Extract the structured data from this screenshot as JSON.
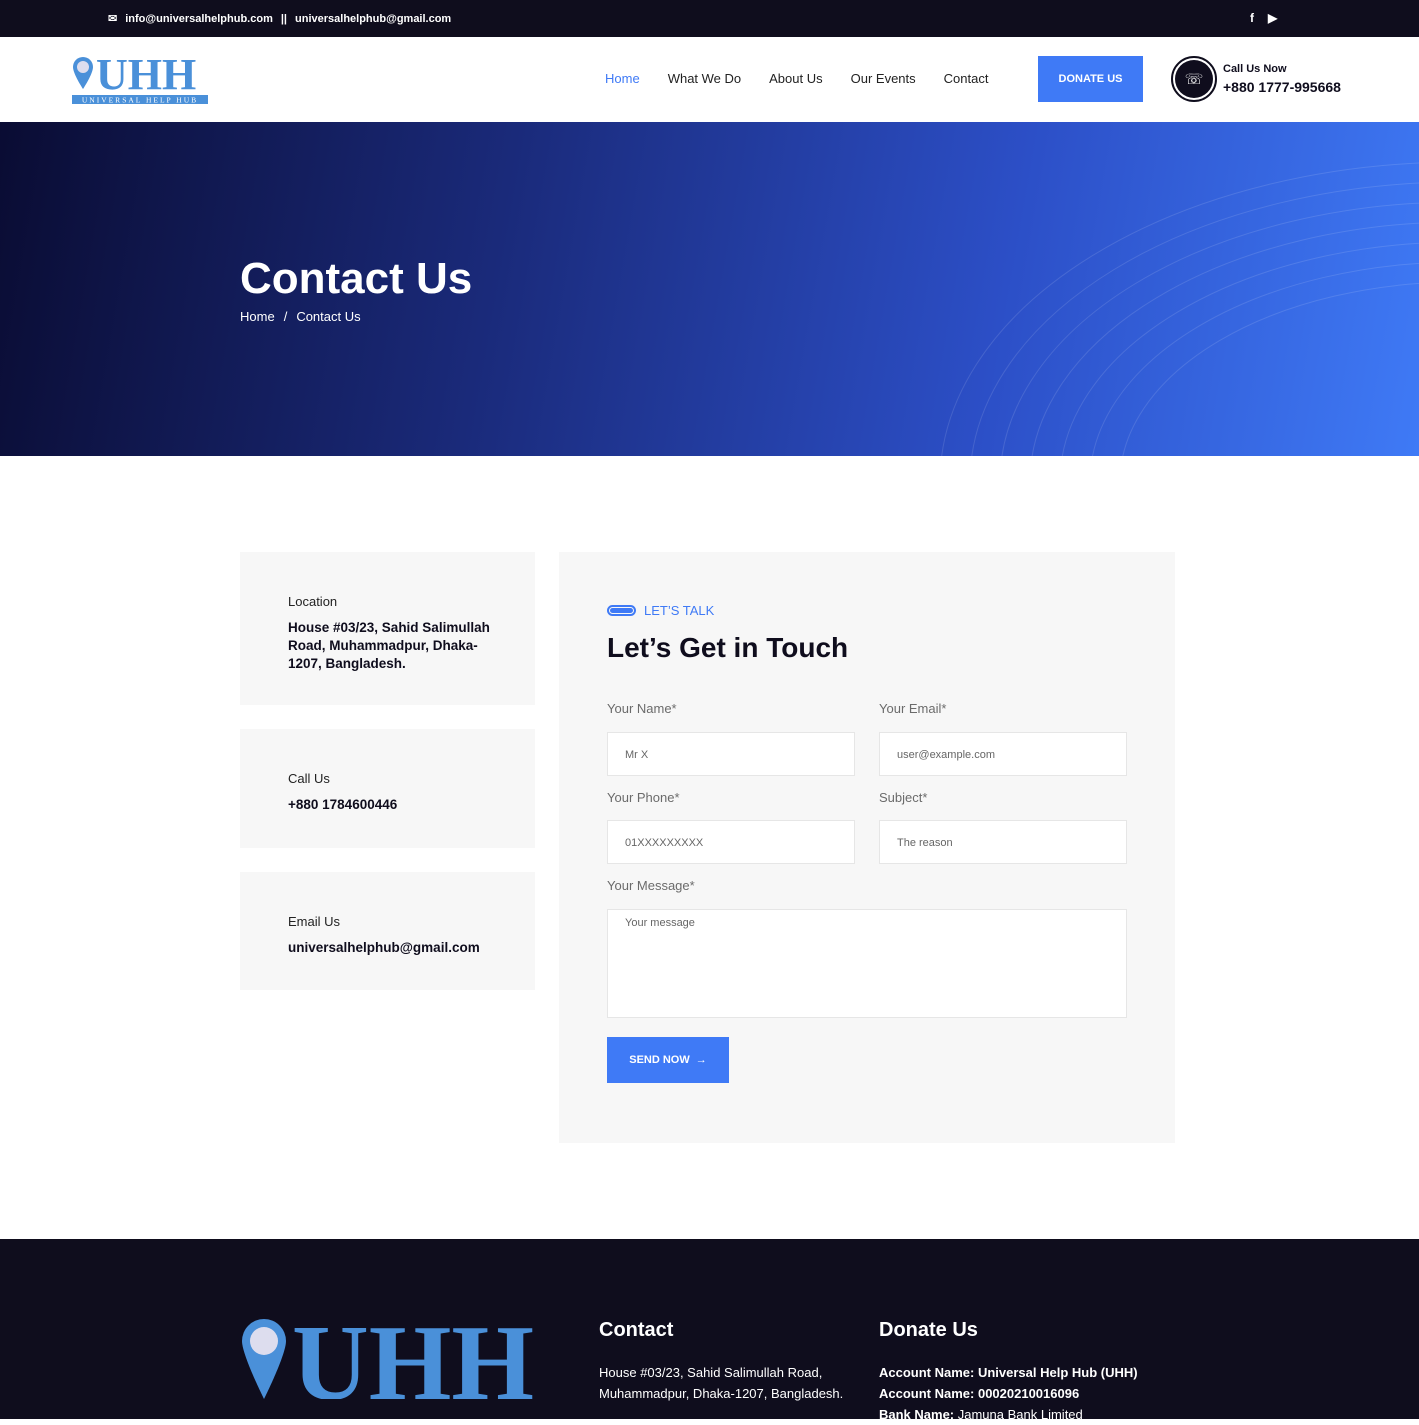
{
  "topbar": {
    "email1": "info@universalhelphub.com",
    "separator": "||",
    "email2": "universalhelphub@gmail.com"
  },
  "header": {
    "logo_text": "UHH",
    "logo_sub": "UNIVERSAL HELP HUB",
    "nav": [
      "Home",
      "What We Do",
      "About Us",
      "Our Events",
      "Contact"
    ],
    "donate": "DONATE US",
    "call_label": "Call Us Now",
    "call_number": "+880 1777-995668"
  },
  "hero": {
    "title": "Contact Us",
    "crumb_home": "Home",
    "crumb_sep": "/",
    "crumb_current": "Contact Us"
  },
  "cards": [
    {
      "label": "Location",
      "value": "House #03/23, Sahid Salimullah Road, Muhammadpur, Dhaka-1207, Bangladesh."
    },
    {
      "label": "Call Us",
      "value": "+880 1784600446"
    },
    {
      "label": "Email Us",
      "value": "universalhelphub@gmail.com"
    }
  ],
  "form": {
    "tag": "LET’S TALK",
    "title": "Let’s Get in Touch",
    "name_label": "Your Name*",
    "name_ph": "Mr X",
    "email_label": "Your Email*",
    "email_ph": "user@example.com",
    "phone_label": "Your Phone*",
    "phone_ph": "01XXXXXXXXX",
    "subject_label": "Subject*",
    "subject_ph": "The reason",
    "message_label": "Your Message*",
    "message_ph": "Your message",
    "send": "SEND NOW"
  },
  "footer": {
    "contact_title": "Contact",
    "contact_l1": "House #03/23, Sahid Salimullah Road,",
    "contact_l2": "Muhammadpur, Dhaka-1207, Bangladesh.",
    "donate_title": "Donate Us",
    "acc_name_k": "Account Name:",
    "acc_name_v": " Universal Help Hub (UHH)",
    "acc_no_k": "Account Name:",
    "acc_no_v": " 00020210016096",
    "bank_k": "Bank Name:",
    "bank_v": " Jamuna Bank Limited"
  },
  "colors": {
    "accent": "#3f7af6",
    "dark": "#0f0d1d"
  }
}
